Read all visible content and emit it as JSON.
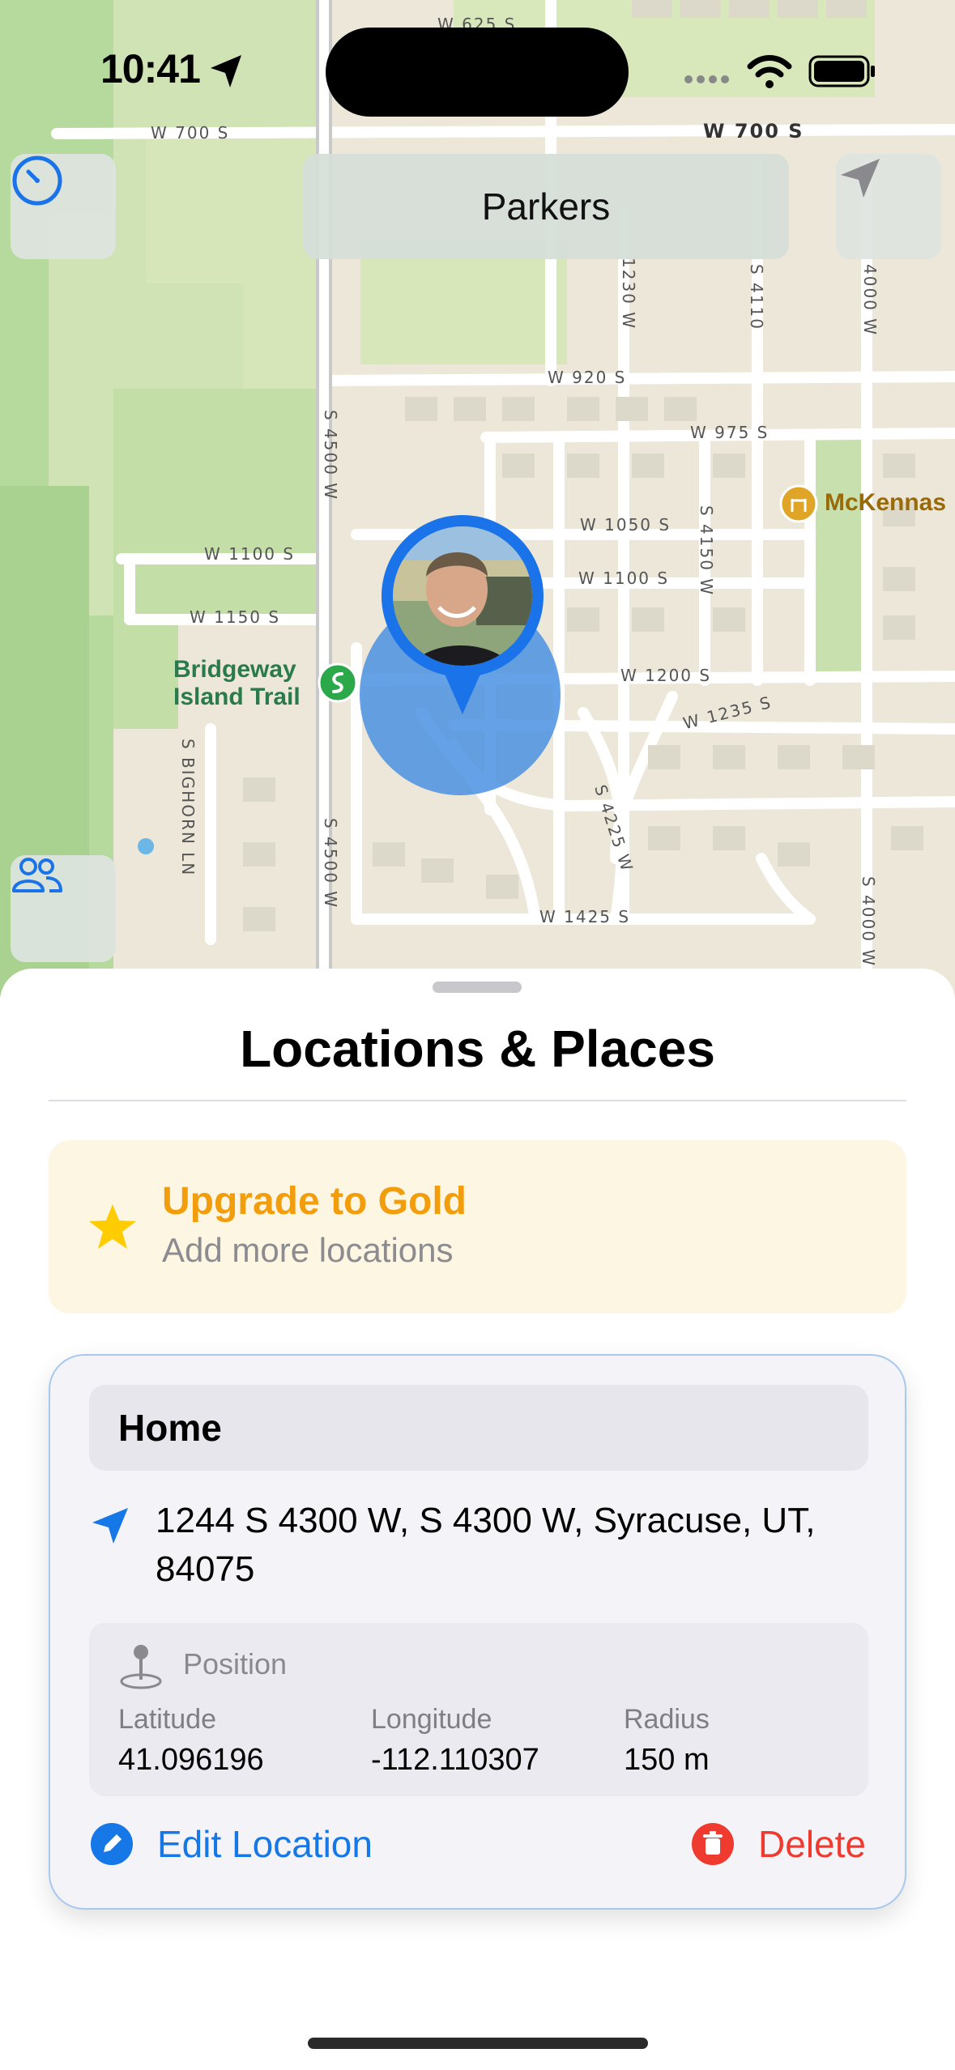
{
  "status_bar": {
    "time": "10:41"
  },
  "map": {
    "title": "Parkers",
    "streets": [
      "W 625 S",
      "W 700 S",
      "W 700 S",
      "1230 W",
      "S 4110",
      "4000 W",
      "W 920 S",
      "W 975 S",
      "S 4500 W",
      "W 1050 S",
      "W 1100 S",
      "W 1100 S",
      "S 4150 W",
      "W 1150 S",
      "W 1200 S",
      "W 1235 S",
      "S BIGHORN LN",
      "S 4500 W",
      "S 4225 W",
      "W 1425 S",
      "S 4000 W"
    ],
    "pois": {
      "trail": "Bridgeway\nIsland Trail",
      "mckennas": "McKennas"
    }
  },
  "sheet": {
    "title": "Locations & Places"
  },
  "upgrade": {
    "title": "Upgrade to Gold",
    "subtitle": "Add more locations"
  },
  "location": {
    "name": "Home",
    "address": "1244 S 4300 W, S 4300 W, Syracuse, UT, 84075",
    "position_label": "Position",
    "latitude_label": "Latitude",
    "latitude": "41.096196",
    "longitude_label": "Longitude",
    "longitude": "-112.110307",
    "radius_label": "Radius",
    "radius": "150 m",
    "edit_label": "Edit Location",
    "delete_label": "Delete"
  },
  "colors": {
    "accent": "#1677e6",
    "gold": "#f29d0c",
    "delete": "#ef3b2f",
    "geofence": "#4a90e2"
  }
}
